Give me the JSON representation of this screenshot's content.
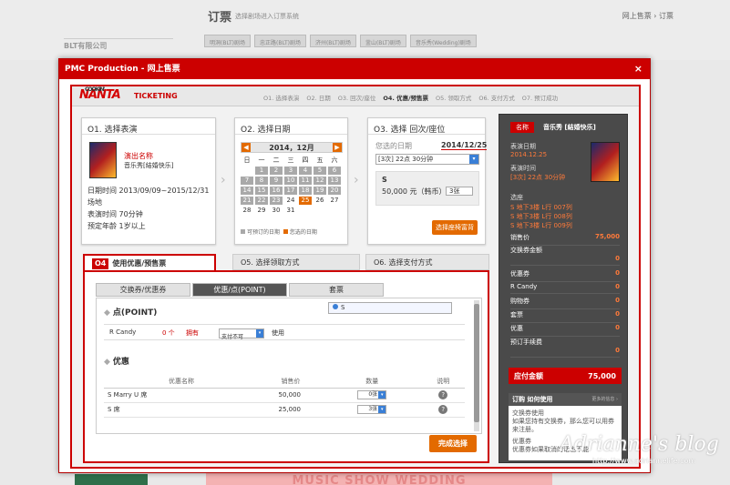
{
  "background": {
    "site_logo": "BLT有限公司",
    "page_title": "订票",
    "page_subtitle": "选择剧场进入订票系统",
    "breadcrumb": "网上售票 › 订票",
    "tabs": [
      "明洞(BLT)剧场",
      "忠正路(BLT)剧场",
      "济州(BLT)剧场",
      "釜山(BLT)剧场",
      "音乐秀(Wedding)剧场"
    ],
    "bottom_banner": "MUSIC SHOW WEDDING"
  },
  "modal": {
    "title": "PMC Production - 网上售票",
    "close": "×",
    "brand_small": "COOKIN'",
    "brand": "NANTA",
    "ticketing": "TICKETING",
    "steps": [
      "O1. 选择表演",
      "O2. 日期",
      "O3. 回次/座位",
      "O4. 优惠/预售票",
      "O5. 领取方式",
      "O6. 支付方式",
      "O7. 预订成功"
    ],
    "step1": {
      "title": "O1. 选择表演",
      "show_label": "演出名称",
      "show_name": "音乐秀[結婚快乐]",
      "period": "日期时间 2013/09/09~2015/12/31",
      "venue": "场地",
      "duration": "表演时间  70分钟",
      "age": "预定年龄  1岁以上"
    },
    "step2": {
      "title": "O2. 选择日期",
      "month": "2014，12月",
      "prev": "◀",
      "next": "▶",
      "weekdays": [
        "日",
        "一",
        "二",
        "三",
        "四",
        "五",
        "六"
      ],
      "days": [
        "",
        "1",
        "2",
        "3",
        "4",
        "5",
        "6",
        "7",
        "8",
        "9",
        "10",
        "11",
        "12",
        "13",
        "14",
        "15",
        "16",
        "17",
        "18",
        "19",
        "20",
        "21",
        "22",
        "23",
        "24",
        "25",
        "26",
        "27",
        "28",
        "29",
        "30",
        "31",
        "",
        "",
        ""
      ],
      "selected_day": "25",
      "legend_available": "可预订的日期",
      "legend_selected": "您选的日期"
    },
    "step3": {
      "title": "O3. 选择 回次/座位",
      "selected_date_label": "您选的日期",
      "selected_date": "2014/12/25",
      "time": "[3次] 22点 30分钟",
      "seat": "S",
      "price": "50,000 元（韩币）",
      "qty": "3张",
      "seat_button": "选择座椅富背"
    },
    "summary": {
      "badge": "名称",
      "name": "音乐秀 [結婚快乐]",
      "date_label": "表演日期",
      "date": "2014.12.25",
      "time_label": "表演时间",
      "time": "[3次] 22点 30分钟",
      "seat_label": "选座",
      "seats": [
        "S 地下3楼 L行 007列",
        "S 地下3楼 L行 008列",
        "S 地下3楼 L行 009列"
      ],
      "rows": [
        {
          "label": "销售价",
          "value": "75,000"
        },
        {
          "label": "交换券金额",
          "value": "0"
        },
        {
          "label": "优惠券",
          "value": "0"
        },
        {
          "label": "R Candy",
          "value": "0"
        },
        {
          "label": "购物券",
          "value": "0"
        },
        {
          "label": "套票",
          "value": "0"
        },
        {
          "label": "优惠",
          "value": "0"
        },
        {
          "label": "预订手续费",
          "value": "0"
        }
      ],
      "total_label": "应付金额",
      "total": "75,000",
      "howto_title": "订购 如何使用",
      "howto_more": "更多的信息 ›",
      "howto_body_1": "交换券使用",
      "howto_body_2": "如果您持有交换券，那么您可以用券来注册。",
      "howto_body_3": "优惠券",
      "howto_body_4": "优惠券如果取消的话也不能"
    },
    "bottom_tabs": {
      "tab4_num": "O4",
      "tab4": "使用优惠/预售票",
      "tab5": "O5. 选择领取方式",
      "tab6": "O6. 选择支付方式"
    },
    "subtabs": [
      "交换券/优惠券",
      "优惠/点(POINT)",
      "套票"
    ],
    "point": {
      "title": "点(POINT)",
      "input": "S",
      "candy_label": "R Candy",
      "candy_count": "0 个",
      "candy_have": "拥有",
      "candy_select": "支付不可",
      "candy_use": "使用"
    },
    "discount": {
      "title": "优惠",
      "headers": [
        "优惠名称",
        "销售价",
        "数量",
        "说明"
      ],
      "rows": [
        {
          "name": "S Marry U 席",
          "price": "50,000",
          "qty": "0张"
        },
        {
          "name": "S 席",
          "price": "25,000",
          "qty": "3张"
        }
      ],
      "help": "?"
    },
    "finish_button": "完成选择"
  },
  "watermark": {
    "text": "Adrianne's blog",
    "url": "http://www.adriannelife.com"
  }
}
